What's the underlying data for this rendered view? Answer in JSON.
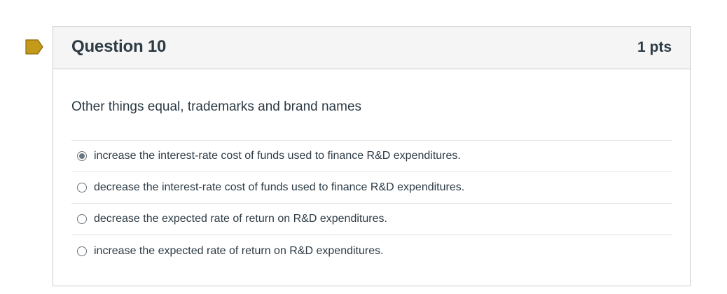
{
  "question": {
    "title": "Question 10",
    "points": "1 pts",
    "text": "Other things equal, trademarks and brand names",
    "flag_color": "#c49a1a",
    "answers": [
      {
        "label": "increase the interest-rate cost of funds used to finance R&D expenditures.",
        "selected": true
      },
      {
        "label": "decrease the interest-rate cost of funds used to finance R&D expenditures.",
        "selected": false
      },
      {
        "label": "decrease the expected rate of return on R&D expenditures.",
        "selected": false
      },
      {
        "label": "increase the expected rate of return on R&D expenditures.",
        "selected": false
      }
    ]
  },
  "icons": {
    "flag": "bookmark-flag-icon",
    "radio": "radio-button-icon"
  }
}
